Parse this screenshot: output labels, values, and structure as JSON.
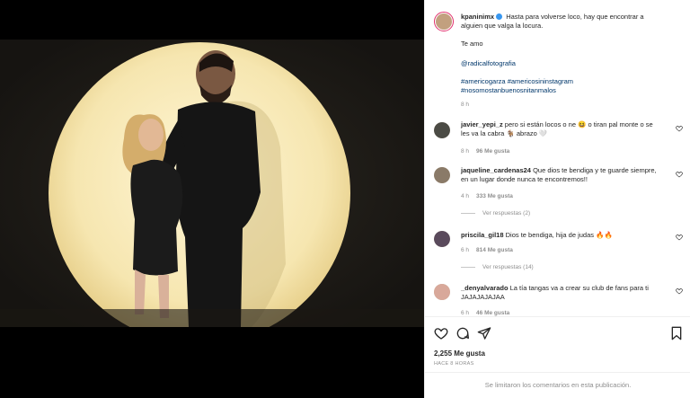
{
  "post": {
    "username": "kpaninimx",
    "caption": "Hasta para volverse loco, hay que encontrar a alguien que valga la locura.",
    "line2": "Te amo",
    "mention": "@radicalfotografia",
    "hashtags": "#americogarza #americosininstagram #nosomostanbuenosnitanmalos",
    "time": "8 h"
  },
  "comments": [
    {
      "user": "javier_yepi_z",
      "text": "pero si están locos o ne 😆 o tiran pal monte o se les va la cabra 🐐 abrazo 🤍",
      "time": "8 h",
      "likes": "96 Me gusta"
    },
    {
      "user": "jaqueline_cardenas24",
      "text": "Que dios te bendiga y te guarde siempre, en un lugar donde nunca te encontremos!!",
      "time": "4 h",
      "likes": "333 Me gusta",
      "replies": "Ver respuestas (2)"
    },
    {
      "user": "priscila_gil18",
      "text": "Dios te bendiga, hija de judas 🔥🔥",
      "time": "6 h",
      "likes": "814 Me gusta",
      "replies": "Ver respuestas (14)"
    },
    {
      "user": "_denyalvarado",
      "text": "La tía tangas va a crear su club de fans para ti JAJAJAJAJAA",
      "time": "6 h",
      "likes": "46 Me gusta"
    }
  ],
  "footer": {
    "likes": "2,255 Me gusta",
    "time_ago": "HACE 8 HORAS",
    "limited": "Se limitaron los comentarios en esta publicación."
  },
  "icons": [
    "heart-icon",
    "comment-icon",
    "share-icon",
    "bookmark-icon"
  ]
}
